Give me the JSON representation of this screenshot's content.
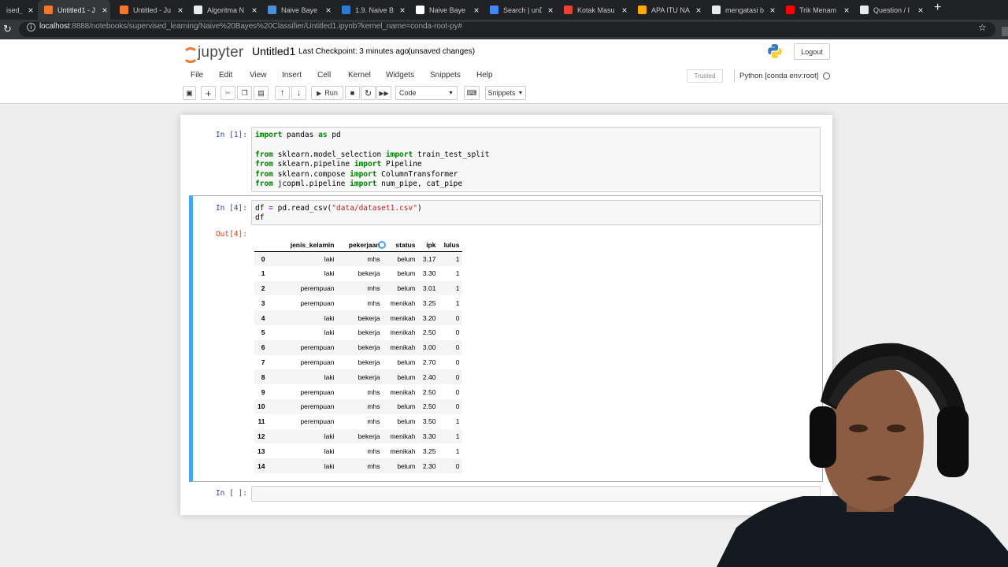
{
  "browser": {
    "tabs": [
      {
        "title": "ised_",
        "icon": "",
        "color": "#d86a2a"
      },
      {
        "title": "Untitled1 - J",
        "icon": "jupyter-icon",
        "color": "#f37726",
        "active": true
      },
      {
        "title": "Untitled - Ju",
        "icon": "jupyter-icon",
        "color": "#f37726"
      },
      {
        "title": "Algoritma N",
        "icon": "site-icon",
        "color": "#e8eaed"
      },
      {
        "title": "Naive Baye",
        "icon": "site-icon",
        "color": "#4a90d9"
      },
      {
        "title": "1.9. Naive B",
        "icon": "site-icon",
        "color": "#2b7bd6"
      },
      {
        "title": "Naive Baye",
        "icon": "medium-icon",
        "color": "#ffffff"
      },
      {
        "title": "Search | unD",
        "icon": "site-icon",
        "color": "#4285f4"
      },
      {
        "title": "Kotak Masu",
        "icon": "gmail-icon",
        "color": "#ea4335"
      },
      {
        "title": "APA ITU NA",
        "icon": "site-icon",
        "color": "#f9ab00"
      },
      {
        "title": "mengatasi b",
        "icon": "google-icon",
        "color": "#e8eaed"
      },
      {
        "title": "Trik Menam",
        "icon": "youtube-icon",
        "color": "#ff0000"
      },
      {
        "title": "Question / I",
        "icon": "github-icon",
        "color": "#e8eaed"
      }
    ],
    "url_host": "localhost",
    "url_rest": ":8888/notebooks/supervised_learning/Naive%20Bayes%20Classifier/Untitled1.ipynb?kernel_name=conda-root-py#"
  },
  "header": {
    "logo_text": "jupyter",
    "notebook_name": "Untitled1",
    "checkpoint": "Last Checkpoint: 3 minutes ago",
    "unsaved": "(unsaved changes)",
    "logout": "Logout"
  },
  "menu": {
    "items": [
      "File",
      "Edit",
      "View",
      "Insert",
      "Cell",
      "Kernel",
      "Widgets",
      "Snippets",
      "Help"
    ],
    "trusted": "Trusted",
    "kernel": "Python [conda env:root]"
  },
  "toolbar": {
    "run": "Run",
    "cell_type": "Code",
    "snippets": "Snippets"
  },
  "cells": {
    "c1_prompt": "In [1]:",
    "c2_prompt": "In [4]:",
    "out_prompt": "Out[4]:",
    "c3_prompt": "In [ ]:"
  },
  "dataframe": {
    "columns": [
      "",
      "jenis_kelamin",
      "pekerjaan",
      "status",
      "ipk",
      "lulus"
    ],
    "rows": [
      [
        "0",
        "laki",
        "mhs",
        "belum",
        "3.17",
        "1"
      ],
      [
        "1",
        "laki",
        "bekerja",
        "belum",
        "3.30",
        "1"
      ],
      [
        "2",
        "perempuan",
        "mhs",
        "belum",
        "3.01",
        "1"
      ],
      [
        "3",
        "perempuan",
        "mhs",
        "menikah",
        "3.25",
        "1"
      ],
      [
        "4",
        "laki",
        "bekerja",
        "menikah",
        "3.20",
        "0"
      ],
      [
        "5",
        "laki",
        "bekerja",
        "menikah",
        "2.50",
        "0"
      ],
      [
        "6",
        "perempuan",
        "bekerja",
        "menikah",
        "3.00",
        "0"
      ],
      [
        "7",
        "perempuan",
        "bekerja",
        "belum",
        "2.70",
        "0"
      ],
      [
        "8",
        "laki",
        "bekerja",
        "belum",
        "2.40",
        "0"
      ],
      [
        "9",
        "perempuan",
        "mhs",
        "menikah",
        "2.50",
        "0"
      ],
      [
        "10",
        "perempuan",
        "mhs",
        "belum",
        "2.50",
        "0"
      ],
      [
        "11",
        "perempuan",
        "mhs",
        "belum",
        "3.50",
        "1"
      ],
      [
        "12",
        "laki",
        "bekerja",
        "menikah",
        "3.30",
        "1"
      ],
      [
        "13",
        "laki",
        "mhs",
        "menikah",
        "3.25",
        "1"
      ],
      [
        "14",
        "laki",
        "mhs",
        "belum",
        "2.30",
        "0"
      ]
    ]
  }
}
